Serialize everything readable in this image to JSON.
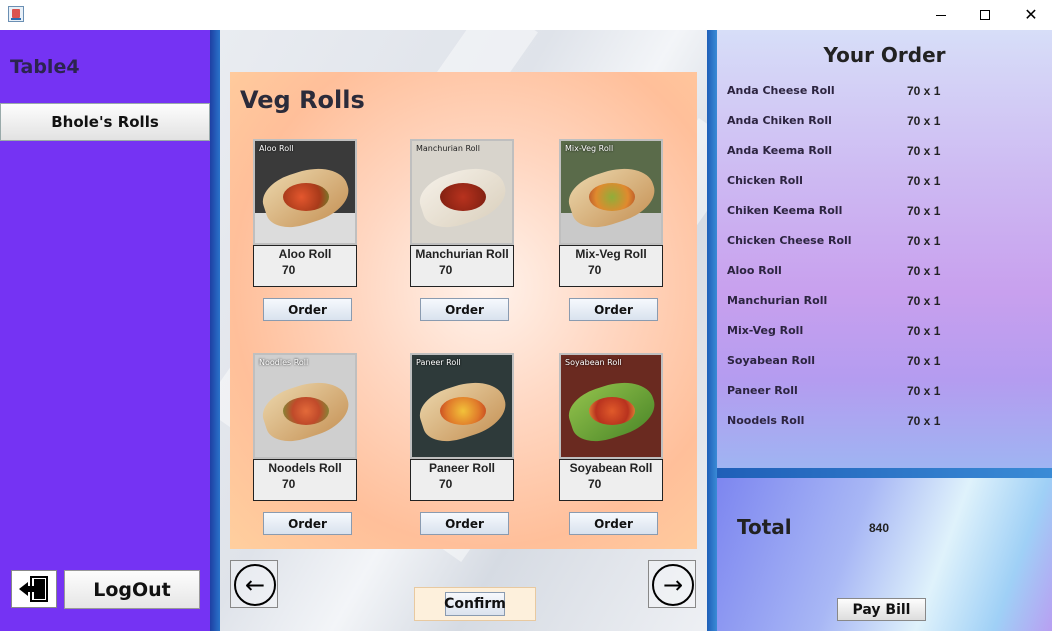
{
  "window": {
    "icon": "java-app-icon"
  },
  "sidebar": {
    "table_label": "Table4",
    "restaurant_button": "Bhole's Rolls",
    "exit_icon": "exit-door-icon",
    "logout_label": "LogOut",
    "background_color": "#7533f3"
  },
  "menu": {
    "title": "Veg Rolls",
    "order_label": "Order",
    "items": [
      {
        "caption": "Aloo Roll",
        "name": "Aloo Roll",
        "price": "70"
      },
      {
        "caption": "Manchurian Roll",
        "name": "Manchurian Roll",
        "price": "70"
      },
      {
        "caption": "Mix-Veg Roll",
        "name": "Mix-Veg Roll",
        "price": "70"
      },
      {
        "caption": "Noodles Roll",
        "name": "Noodels Roll",
        "price": "70"
      },
      {
        "caption": "Paneer Roll",
        "name": "Paneer Roll",
        "price": "70"
      },
      {
        "caption": "Soyabean Roll",
        "name": "Soyabean Roll",
        "price": "70"
      }
    ],
    "prev_icon": "arrow-left-circle-icon",
    "next_icon": "arrow-right-circle-icon",
    "confirm_label": "Confirm"
  },
  "order": {
    "title": "Your Order",
    "items": [
      {
        "name": "Anda Cheese Roll",
        "qty": "70 x 1"
      },
      {
        "name": "Anda Chiken Roll",
        "qty": "70 x 1"
      },
      {
        "name": "Anda Keema Roll",
        "qty": "70 x 1"
      },
      {
        "name": "Chicken Roll",
        "qty": "70 x 1"
      },
      {
        "name": "Chiken Keema Roll",
        "qty": "70 x 1"
      },
      {
        "name": "Chicken Cheese Roll",
        "qty": "70 x 1"
      },
      {
        "name": "Aloo Roll",
        "qty": "70 x 1"
      },
      {
        "name": "Manchurian Roll",
        "qty": "70 x 1"
      },
      {
        "name": "Mix-Veg Roll",
        "qty": "70 x 1"
      },
      {
        "name": "Soyabean Roll",
        "qty": "70 x 1"
      },
      {
        "name": "Paneer Roll",
        "qty": "70 x 1"
      },
      {
        "name": "Noodels Roll",
        "qty": "70 x 1"
      }
    ]
  },
  "bill": {
    "total_label": "Total",
    "total_value": "840",
    "pay_label": "Pay Bill"
  }
}
